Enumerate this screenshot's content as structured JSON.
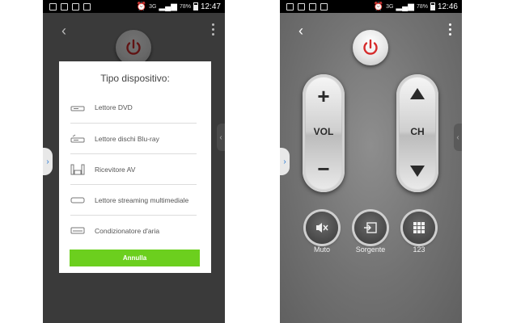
{
  "left_screen": {
    "status": {
      "time": "12:47",
      "battery": "78%",
      "network": "3G"
    },
    "dialog": {
      "title": "Tipo dispositivo:",
      "items": [
        {
          "label": "Lettore DVD",
          "icon": "dvd-player-icon"
        },
        {
          "label": "Lettore dischi Blu-ray",
          "icon": "bluray-player-icon"
        },
        {
          "label": "Ricevitore AV",
          "icon": "av-receiver-icon"
        },
        {
          "label": "Lettore streaming multimediale",
          "icon": "streaming-player-icon"
        },
        {
          "label": "Condizionatore d'aria",
          "icon": "air-conditioner-icon"
        }
      ],
      "cancel_label": "Annulla"
    }
  },
  "right_screen": {
    "status": {
      "time": "12:46",
      "battery": "78%",
      "network": "3G"
    },
    "volume": {
      "label": "VOL",
      "up": "+",
      "down": "−"
    },
    "channel": {
      "label": "CH"
    },
    "buttons": [
      {
        "label": "Muto",
        "icon": "mute-icon"
      },
      {
        "label": "Sorgente",
        "icon": "source-icon"
      },
      {
        "label": "123",
        "icon": "keypad-icon"
      }
    ]
  },
  "colors": {
    "power_red": "#d62a2a",
    "accent_green": "#6ccf1e",
    "tab_blue": "#2a7bd6"
  }
}
